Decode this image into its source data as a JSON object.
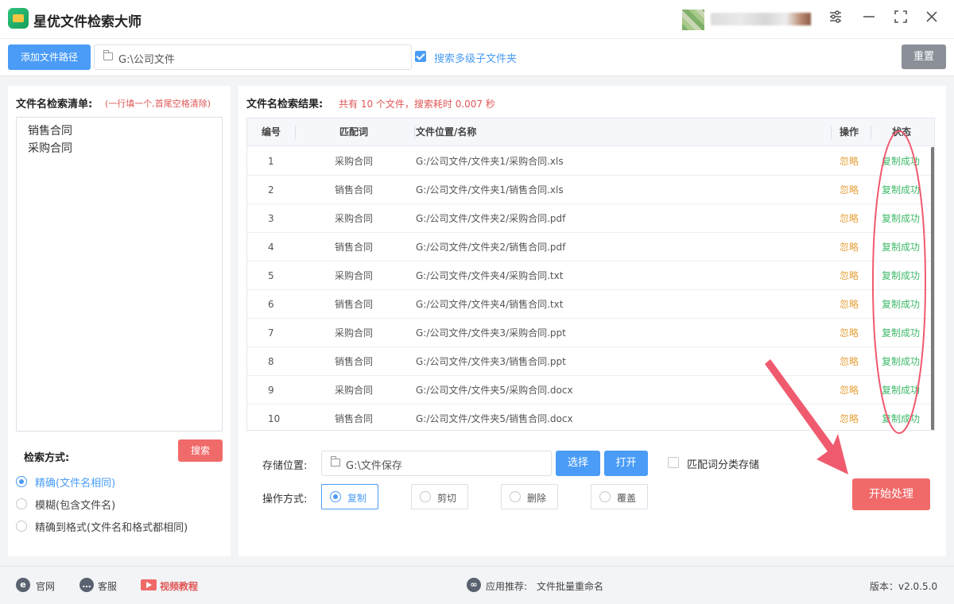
{
  "app": {
    "title": "星优文件检索大师"
  },
  "toolbar": {
    "add_path_label": "添加文件路径",
    "path_value": "G:\\公司文件",
    "subfolder_label": "搜索多级子文件夹",
    "subfolder_checked": true,
    "reset_label": "重置"
  },
  "left": {
    "list_title": "文件名检索清单:",
    "list_hint": "(一行填一个,首尾空格清除)",
    "list_lines": [
      "销售合同",
      "采购合同"
    ],
    "search_label": "搜索",
    "mode_title": "检索方式:",
    "modes": [
      {
        "label": "精确(文件名相同)",
        "selected": true
      },
      {
        "label": "模糊(包含文件名)",
        "selected": false
      },
      {
        "label": "精确到格式(文件名和格式都相同)",
        "selected": false
      }
    ]
  },
  "results": {
    "title": "文件名检索结果:",
    "summary": "共有 10 个文件，搜索耗时 0.007 秒",
    "columns": [
      "编号",
      "匹配词",
      "文件位置/名称",
      "操作",
      "状态"
    ],
    "rows": [
      {
        "no": "1",
        "word": "采购合同",
        "path": "G:/公司文件/文件夹1/采购合同.xls",
        "op": "忽略",
        "status": "复制成功"
      },
      {
        "no": "2",
        "word": "销售合同",
        "path": "G:/公司文件/文件夹1/销售合同.xls",
        "op": "忽略",
        "status": "复制成功"
      },
      {
        "no": "3",
        "word": "采购合同",
        "path": "G:/公司文件/文件夹2/采购合同.pdf",
        "op": "忽略",
        "status": "复制成功"
      },
      {
        "no": "4",
        "word": "销售合同",
        "path": "G:/公司文件/文件夹2/销售合同.pdf",
        "op": "忽略",
        "status": "复制成功"
      },
      {
        "no": "5",
        "word": "采购合同",
        "path": "G:/公司文件/文件夹4/采购合同.txt",
        "op": "忽略",
        "status": "复制成功"
      },
      {
        "no": "6",
        "word": "销售合同",
        "path": "G:/公司文件/文件夹4/销售合同.txt",
        "op": "忽略",
        "status": "复制成功"
      },
      {
        "no": "7",
        "word": "采购合同",
        "path": "G:/公司文件/文件夹3/采购合同.ppt",
        "op": "忽略",
        "status": "复制成功"
      },
      {
        "no": "8",
        "word": "销售合同",
        "path": "G:/公司文件/文件夹3/销售合同.ppt",
        "op": "忽略",
        "status": "复制成功"
      },
      {
        "no": "9",
        "word": "采购合同",
        "path": "G:/公司文件/文件夹5/采购合同.docx",
        "op": "忽略",
        "status": "复制成功"
      },
      {
        "no": "10",
        "word": "销售合同",
        "path": "G:/公司文件/文件夹5/销售合同.docx",
        "op": "忽略",
        "status": "复制成功"
      }
    ]
  },
  "bottom": {
    "save_label": "存储位置:",
    "save_path": "G:\\文件保存",
    "choose_label": "选择",
    "open_label": "打开",
    "classify_label": "匹配词分类存储",
    "classify_checked": false,
    "op_label": "操作方式:",
    "ops": [
      {
        "label": "复制",
        "selected": true
      },
      {
        "label": "剪切",
        "selected": false
      },
      {
        "label": "删除",
        "selected": false
      },
      {
        "label": "覆盖",
        "selected": false
      }
    ],
    "start_label": "开始处理"
  },
  "footer": {
    "website": "官网",
    "service": "客服",
    "video": "视频教程",
    "recommend_label": "应用推荐:",
    "recommend_app": "文件批量重命名",
    "version": "版本：v2.0.5.0"
  },
  "colors": {
    "primary": "#4a9cf6",
    "danger": "#f16a6a",
    "success": "#3fb96a",
    "warning": "#e6a23c",
    "annotation": "#f05a6e"
  }
}
